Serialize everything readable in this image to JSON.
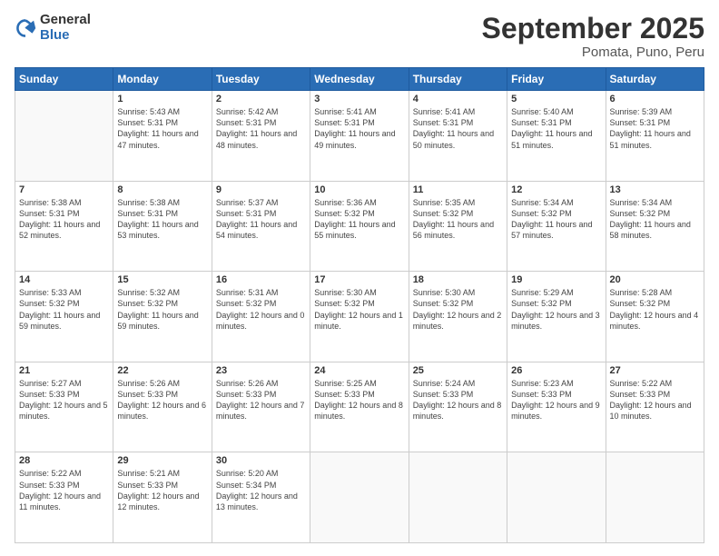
{
  "header": {
    "logo_general": "General",
    "logo_blue": "Blue",
    "month_title": "September 2025",
    "location": "Pomata, Puno, Peru"
  },
  "weekdays": [
    "Sunday",
    "Monday",
    "Tuesday",
    "Wednesday",
    "Thursday",
    "Friday",
    "Saturday"
  ],
  "weeks": [
    [
      {
        "day": "",
        "sunrise": "",
        "sunset": "",
        "daylight": ""
      },
      {
        "day": "1",
        "sunrise": "Sunrise: 5:43 AM",
        "sunset": "Sunset: 5:31 PM",
        "daylight": "Daylight: 11 hours and 47 minutes."
      },
      {
        "day": "2",
        "sunrise": "Sunrise: 5:42 AM",
        "sunset": "Sunset: 5:31 PM",
        "daylight": "Daylight: 11 hours and 48 minutes."
      },
      {
        "day": "3",
        "sunrise": "Sunrise: 5:41 AM",
        "sunset": "Sunset: 5:31 PM",
        "daylight": "Daylight: 11 hours and 49 minutes."
      },
      {
        "day": "4",
        "sunrise": "Sunrise: 5:41 AM",
        "sunset": "Sunset: 5:31 PM",
        "daylight": "Daylight: 11 hours and 50 minutes."
      },
      {
        "day": "5",
        "sunrise": "Sunrise: 5:40 AM",
        "sunset": "Sunset: 5:31 PM",
        "daylight": "Daylight: 11 hours and 51 minutes."
      },
      {
        "day": "6",
        "sunrise": "Sunrise: 5:39 AM",
        "sunset": "Sunset: 5:31 PM",
        "daylight": "Daylight: 11 hours and 51 minutes."
      }
    ],
    [
      {
        "day": "7",
        "sunrise": "Sunrise: 5:38 AM",
        "sunset": "Sunset: 5:31 PM",
        "daylight": "Daylight: 11 hours and 52 minutes."
      },
      {
        "day": "8",
        "sunrise": "Sunrise: 5:38 AM",
        "sunset": "Sunset: 5:31 PM",
        "daylight": "Daylight: 11 hours and 53 minutes."
      },
      {
        "day": "9",
        "sunrise": "Sunrise: 5:37 AM",
        "sunset": "Sunset: 5:31 PM",
        "daylight": "Daylight: 11 hours and 54 minutes."
      },
      {
        "day": "10",
        "sunrise": "Sunrise: 5:36 AM",
        "sunset": "Sunset: 5:32 PM",
        "daylight": "Daylight: 11 hours and 55 minutes."
      },
      {
        "day": "11",
        "sunrise": "Sunrise: 5:35 AM",
        "sunset": "Sunset: 5:32 PM",
        "daylight": "Daylight: 11 hours and 56 minutes."
      },
      {
        "day": "12",
        "sunrise": "Sunrise: 5:34 AM",
        "sunset": "Sunset: 5:32 PM",
        "daylight": "Daylight: 11 hours and 57 minutes."
      },
      {
        "day": "13",
        "sunrise": "Sunrise: 5:34 AM",
        "sunset": "Sunset: 5:32 PM",
        "daylight": "Daylight: 11 hours and 58 minutes."
      }
    ],
    [
      {
        "day": "14",
        "sunrise": "Sunrise: 5:33 AM",
        "sunset": "Sunset: 5:32 PM",
        "daylight": "Daylight: 11 hours and 59 minutes."
      },
      {
        "day": "15",
        "sunrise": "Sunrise: 5:32 AM",
        "sunset": "Sunset: 5:32 PM",
        "daylight": "Daylight: 11 hours and 59 minutes."
      },
      {
        "day": "16",
        "sunrise": "Sunrise: 5:31 AM",
        "sunset": "Sunset: 5:32 PM",
        "daylight": "Daylight: 12 hours and 0 minutes."
      },
      {
        "day": "17",
        "sunrise": "Sunrise: 5:30 AM",
        "sunset": "Sunset: 5:32 PM",
        "daylight": "Daylight: 12 hours and 1 minute."
      },
      {
        "day": "18",
        "sunrise": "Sunrise: 5:30 AM",
        "sunset": "Sunset: 5:32 PM",
        "daylight": "Daylight: 12 hours and 2 minutes."
      },
      {
        "day": "19",
        "sunrise": "Sunrise: 5:29 AM",
        "sunset": "Sunset: 5:32 PM",
        "daylight": "Daylight: 12 hours and 3 minutes."
      },
      {
        "day": "20",
        "sunrise": "Sunrise: 5:28 AM",
        "sunset": "Sunset: 5:32 PM",
        "daylight": "Daylight: 12 hours and 4 minutes."
      }
    ],
    [
      {
        "day": "21",
        "sunrise": "Sunrise: 5:27 AM",
        "sunset": "Sunset: 5:33 PM",
        "daylight": "Daylight: 12 hours and 5 minutes."
      },
      {
        "day": "22",
        "sunrise": "Sunrise: 5:26 AM",
        "sunset": "Sunset: 5:33 PM",
        "daylight": "Daylight: 12 hours and 6 minutes."
      },
      {
        "day": "23",
        "sunrise": "Sunrise: 5:26 AM",
        "sunset": "Sunset: 5:33 PM",
        "daylight": "Daylight: 12 hours and 7 minutes."
      },
      {
        "day": "24",
        "sunrise": "Sunrise: 5:25 AM",
        "sunset": "Sunset: 5:33 PM",
        "daylight": "Daylight: 12 hours and 8 minutes."
      },
      {
        "day": "25",
        "sunrise": "Sunrise: 5:24 AM",
        "sunset": "Sunset: 5:33 PM",
        "daylight": "Daylight: 12 hours and 8 minutes."
      },
      {
        "day": "26",
        "sunrise": "Sunrise: 5:23 AM",
        "sunset": "Sunset: 5:33 PM",
        "daylight": "Daylight: 12 hours and 9 minutes."
      },
      {
        "day": "27",
        "sunrise": "Sunrise: 5:22 AM",
        "sunset": "Sunset: 5:33 PM",
        "daylight": "Daylight: 12 hours and 10 minutes."
      }
    ],
    [
      {
        "day": "28",
        "sunrise": "Sunrise: 5:22 AM",
        "sunset": "Sunset: 5:33 PM",
        "daylight": "Daylight: 12 hours and 11 minutes."
      },
      {
        "day": "29",
        "sunrise": "Sunrise: 5:21 AM",
        "sunset": "Sunset: 5:33 PM",
        "daylight": "Daylight: 12 hours and 12 minutes."
      },
      {
        "day": "30",
        "sunrise": "Sunrise: 5:20 AM",
        "sunset": "Sunset: 5:34 PM",
        "daylight": "Daylight: 12 hours and 13 minutes."
      },
      {
        "day": "",
        "sunrise": "",
        "sunset": "",
        "daylight": ""
      },
      {
        "day": "",
        "sunrise": "",
        "sunset": "",
        "daylight": ""
      },
      {
        "day": "",
        "sunrise": "",
        "sunset": "",
        "daylight": ""
      },
      {
        "day": "",
        "sunrise": "",
        "sunset": "",
        "daylight": ""
      }
    ]
  ]
}
